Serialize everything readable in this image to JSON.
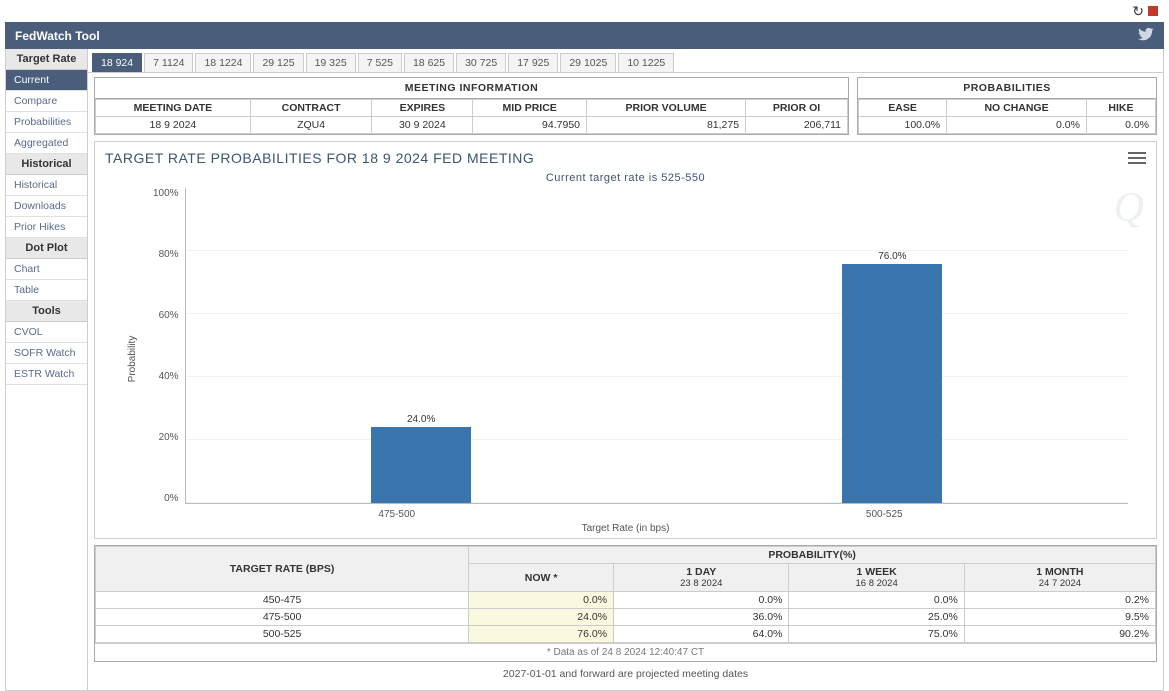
{
  "topbar": {
    "title": "FedWatch Tool"
  },
  "sidebar": {
    "sections": [
      {
        "head": "Target Rate",
        "items": [
          "Current",
          "Compare",
          "Probabilities",
          "Aggregated"
        ],
        "activeIndex": 0
      },
      {
        "head": "Historical",
        "items": [
          "Historical",
          "Downloads",
          "Prior Hikes"
        ],
        "activeIndex": -1
      },
      {
        "head": "Dot Plot",
        "items": [
          "Chart",
          "Table"
        ],
        "activeIndex": -1
      },
      {
        "head": "Tools",
        "items": [
          "CVOL",
          "SOFR Watch",
          "ESTR Watch"
        ],
        "activeIndex": -1
      }
    ]
  },
  "tabs": {
    "items": [
      "18 924",
      "7 1124",
      "18 1224",
      "29 125",
      "19 325",
      "7 525",
      "18 625",
      "30 725",
      "17 925",
      "29 1025",
      "10 1225"
    ],
    "activeIndex": 0
  },
  "meeting_info": {
    "title": "MEETING INFORMATION",
    "headers": [
      "MEETING DATE",
      "CONTRACT",
      "EXPIRES",
      "MID PRICE",
      "PRIOR VOLUME",
      "PRIOR OI"
    ],
    "values": [
      "18 9 2024",
      "ZQU4",
      "30 9 2024",
      "94.7950",
      "81,275",
      "206,711"
    ]
  },
  "prob_info": {
    "title": "PROBABILITIES",
    "headers": [
      "EASE",
      "NO CHANGE",
      "HIKE"
    ],
    "values": [
      "100.0%",
      "0.0%",
      "0.0%"
    ]
  },
  "chart_title": "TARGET RATE PROBABILITIES FOR 18 9 2024 FED MEETING",
  "chart_subtitle": "Current target rate is 525-550",
  "chart_data": {
    "type": "bar",
    "categories": [
      "475-500",
      "500-525"
    ],
    "values": [
      24.0,
      76.0
    ],
    "value_labels": [
      "24.0%",
      "76.0%"
    ],
    "title": "TARGET RATE PROBABILITIES FOR 18 9 2024 FED MEETING",
    "xlabel": "Target Rate (in bps)",
    "ylabel": "Probability",
    "ylim": [
      0,
      100
    ],
    "yticks": [
      "100%",
      "80%",
      "60%",
      "40%",
      "20%",
      "0%"
    ]
  },
  "history_table": {
    "left_head": "TARGET RATE (BPS)",
    "right_head": "PROBABILITY(%)",
    "cols": [
      {
        "top": "NOW *",
        "sub": ""
      },
      {
        "top": "1 DAY",
        "sub": "23 8 2024"
      },
      {
        "top": "1 WEEK",
        "sub": "16 8 2024"
      },
      {
        "top": "1 MONTH",
        "sub": "24 7 2024"
      }
    ],
    "rows": [
      {
        "label": "450-475",
        "vals": [
          "0.0%",
          "0.0%",
          "0.0%",
          "0.2%"
        ]
      },
      {
        "label": "475-500",
        "vals": [
          "24.0%",
          "36.0%",
          "25.0%",
          "9.5%"
        ]
      },
      {
        "label": "500-525",
        "vals": [
          "76.0%",
          "64.0%",
          "75.0%",
          "90.2%"
        ]
      }
    ],
    "asterisk": "* Data as of 24 8 2024 12:40:47 CT"
  },
  "footer_note": "2027-01-01 and forward are projected meeting dates"
}
